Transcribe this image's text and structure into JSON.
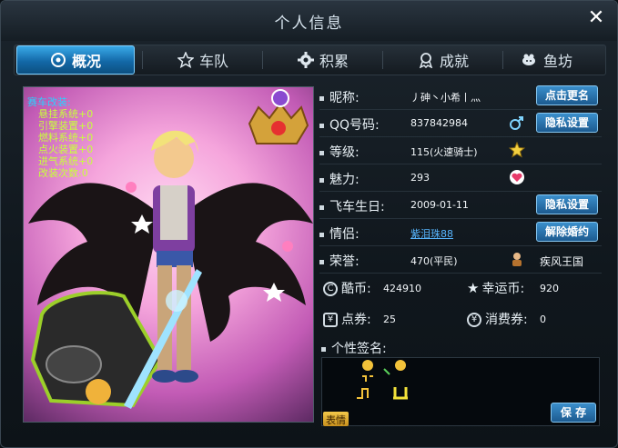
{
  "window": {
    "title": "个人信息",
    "close_label": "✕"
  },
  "tabs": [
    {
      "label": "概况",
      "icon": "target-icon",
      "active": true
    },
    {
      "label": "车队",
      "icon": "star-icon",
      "active": false
    },
    {
      "label": "积累",
      "icon": "gear-icon",
      "active": false
    },
    {
      "label": "成就",
      "icon": "medal-icon",
      "active": false
    },
    {
      "label": "鱼坊",
      "icon": "fish-icon",
      "active": false
    }
  ],
  "avatar": {
    "stats_title": "赛车改装:",
    "stats": [
      "悬挂系统+0",
      "引擎装置+0",
      "燃料系统+0",
      "点火装置+0",
      "进气系统+0",
      "改装次数:0"
    ]
  },
  "profile": {
    "nickname": {
      "label": "昵称:",
      "value": "丿砷丶小希丨灬",
      "button": "点击更名"
    },
    "qq": {
      "label": "QQ号码:",
      "value": "837842984",
      "button": "隐私设置"
    },
    "level": {
      "label": "等级:",
      "value": "115(火速骑士)"
    },
    "charm": {
      "label": "魅力:",
      "value": "293"
    },
    "birthday": {
      "label": "飞车生日:",
      "value": "2009-01-11",
      "button": "隐私设置"
    },
    "partner": {
      "label": "情侣:",
      "value": "紫泪珠88",
      "button": "解除婚约"
    },
    "honor": {
      "label": "荣誉:",
      "value": "470(平民)",
      "extra": "疾风王国"
    }
  },
  "currency": {
    "cool_coin": {
      "label": "酷币:",
      "value": "424910"
    },
    "lucky_coin": {
      "label": "幸运币:",
      "value": "920"
    },
    "coupon": {
      "label": "点券:",
      "value": "25"
    },
    "consume_coupon": {
      "label": "消费券:",
      "value": "0"
    }
  },
  "signature": {
    "label": "个性签名:",
    "save": "保 存",
    "emoji": "表情"
  }
}
